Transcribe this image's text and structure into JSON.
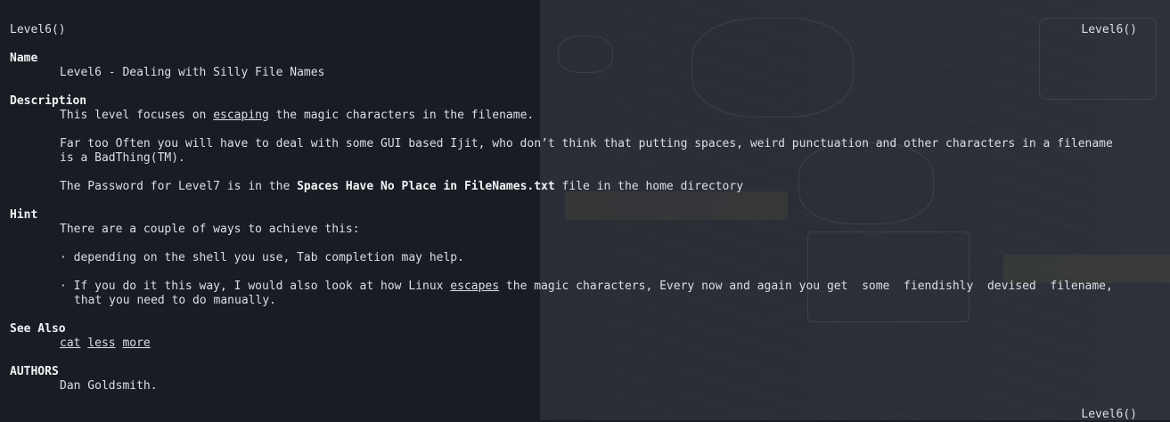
{
  "manpage": {
    "header_left": "Level6()",
    "header_right": "Level6()",
    "footer_right": "Level6()",
    "name_heading": "Name",
    "name_text": "Level6 - Dealing with Silly File Names",
    "description_heading": "Description",
    "desc_line1_a": "This level focuses on ",
    "desc_line1_link": "escaping",
    "desc_line1_b": " the magic characters in the filename.",
    "desc_line2": "Far too Often you will have to deal with some GUI based Ijit, who don’t think that putting spaces, weird punctuation and other characters in a filename",
    "desc_line3": "is a BadThing(TM).",
    "desc_line4_a": "The Password for Level7 is in the ",
    "desc_line4_bold": "Spaces Have No Place in FileNames.txt",
    "desc_line4_b": " file in the home directory",
    "hint_heading": "Hint",
    "hint_line1": "There are a couple of ways to achieve this:",
    "hint_bullet1": "· depending on the shell you use, Tab completion may help.",
    "hint_bullet2_a": "· If you do it this way, I would also look at how Linux ",
    "hint_bullet2_link": "escapes",
    "hint_bullet2_b": " the magic characters, Every now and again you get  some  fiendishly  devised  filename,",
    "hint_bullet2_cont": "that you need to do manually.",
    "see_also_heading": "See Also",
    "see_also_links": [
      "cat",
      "less",
      "more"
    ],
    "authors_heading": "AUTHORS",
    "authors_text": "Dan Goldsmith."
  },
  "colors": {
    "background": "#1a1d24",
    "text": "#dcdfe4",
    "bold_text": "#f0f2f5"
  }
}
